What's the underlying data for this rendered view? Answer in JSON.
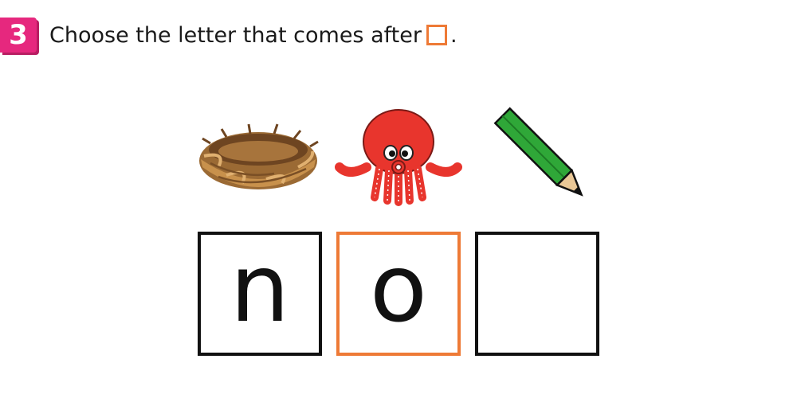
{
  "question": {
    "number": "3",
    "text": "Choose the letter that comes after",
    "period": "."
  },
  "pictures": [
    {
      "icon": "nest-icon"
    },
    {
      "icon": "octopus-icon"
    },
    {
      "icon": "pencil-icon"
    }
  ],
  "tiles": [
    {
      "letter": "n"
    },
    {
      "letter": "o"
    },
    {
      "letter": ""
    }
  ],
  "colors": {
    "badge": "#e6287e",
    "highlight": "#ee7a36",
    "octopus": "#e8352d",
    "pencil": "#2fa738",
    "nest": "#b07a3c"
  }
}
